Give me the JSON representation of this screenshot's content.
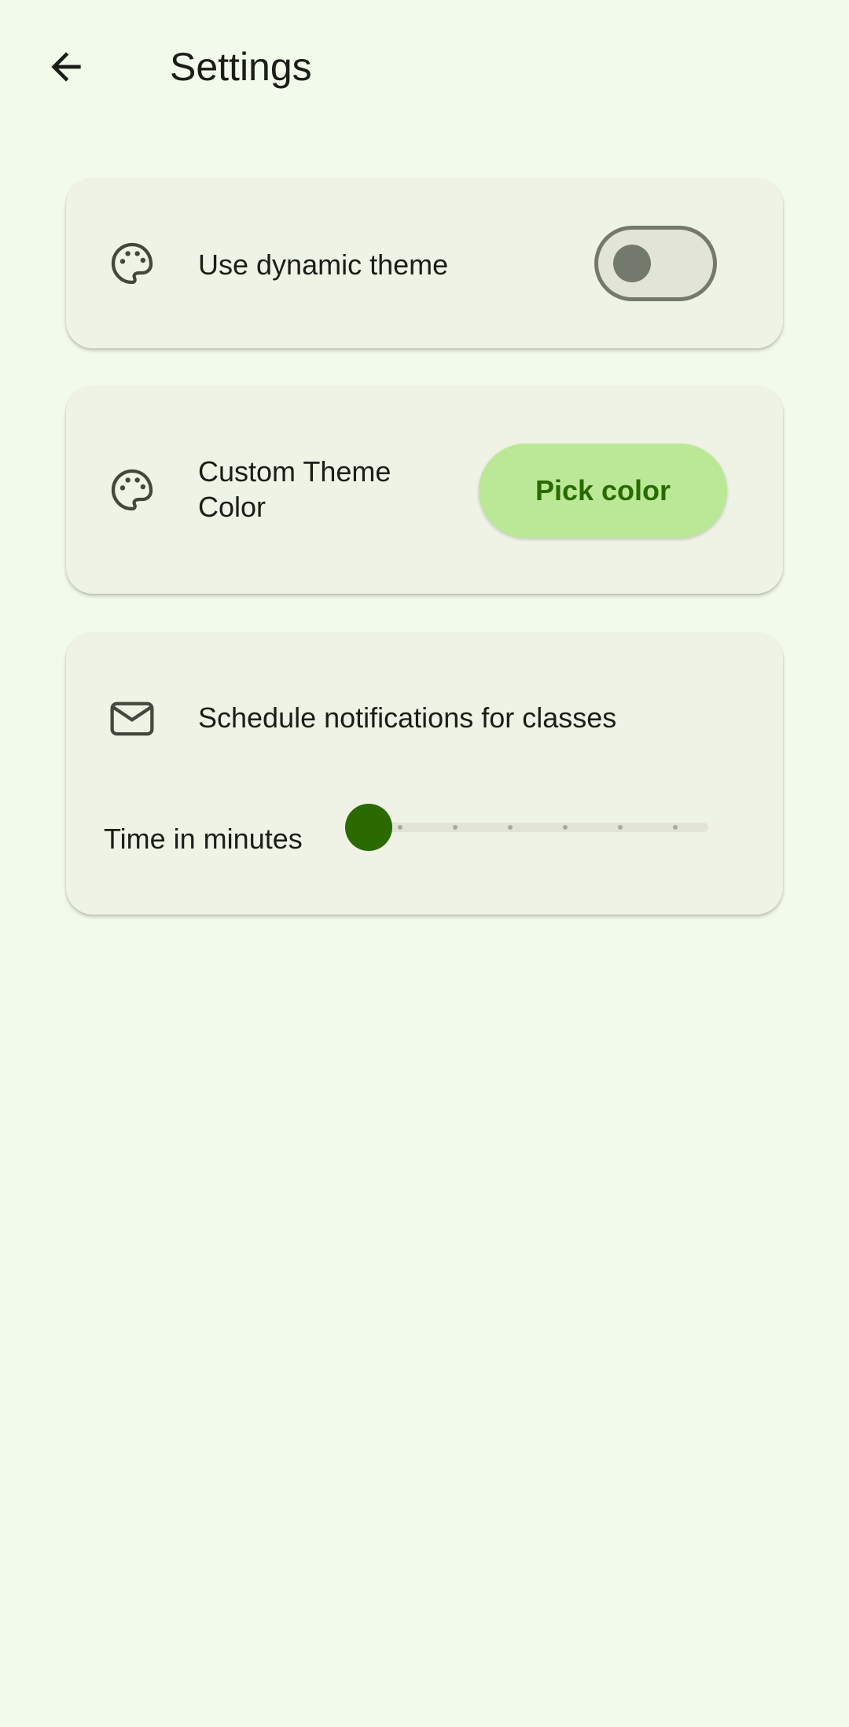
{
  "header": {
    "title": "Settings",
    "back_icon": "arrow-back-icon"
  },
  "settings": {
    "dynamic_theme": {
      "icon": "palette-icon",
      "label": "Use dynamic theme",
      "enabled": false
    },
    "custom_theme": {
      "icon": "palette-icon",
      "label_line1": "Custom Theme",
      "label_line2": "Color",
      "button_label": "Pick color"
    },
    "notifications": {
      "icon": "mail-icon",
      "label": "Schedule notifications for classes",
      "slider_label": "Time in minutes",
      "slider_value_fraction": 0,
      "slider_steps": 6
    }
  },
  "colors": {
    "background": "#f2faeb",
    "card": "#eff3e5",
    "accent": "#2b6a00",
    "button_container": "#bbe896",
    "outline": "#74796d"
  }
}
